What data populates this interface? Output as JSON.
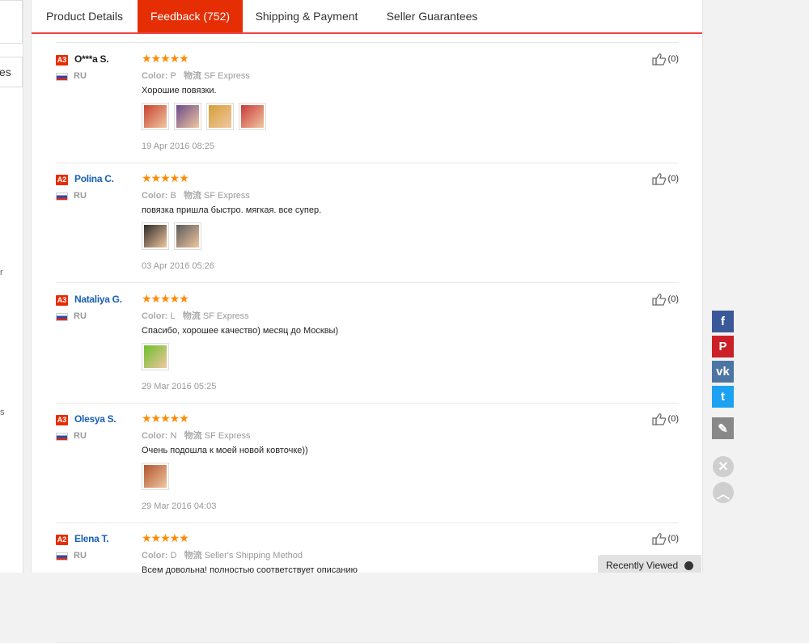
{
  "tabs": [
    {
      "label": "Product Details"
    },
    {
      "label": "Feedback (752)"
    },
    {
      "label": "Shipping & Payment"
    },
    {
      "label": "Seller Guarantees"
    }
  ],
  "left_fragments": {
    "es": "es",
    "r": "r",
    "s": "s"
  },
  "colors": {
    "accent": "#e62e04",
    "star": "#ff8a00",
    "link": "#1a5fb4"
  },
  "reviews": [
    {
      "badge": "A3",
      "name": "O***a S.",
      "country": "RU",
      "stars": "★★★★★",
      "color_key": "Color:",
      "color_val": "P",
      "ship_key": "物流",
      "ship_val": "SF Express",
      "text": "Хорошие повязки.",
      "date": "19 Apr 2016 08:25",
      "likes": "(0)",
      "thumb_colors": [
        "#c6422f",
        "#6b4a8a",
        "#d6a03a",
        "#c83a3a"
      ]
    },
    {
      "badge": "A2",
      "name": "Polina C.",
      "country": "RU",
      "stars": "★★★★★",
      "color_key": "Color:",
      "color_val": "B",
      "ship_key": "物流",
      "ship_val": "SF Express",
      "text": "повязка пришла быстро. мягкая. все супер.",
      "date": "03 Apr 2016 05:26",
      "likes": "(0)",
      "thumb_colors": [
        "#2e2a28",
        "#5a5a5a"
      ]
    },
    {
      "badge": "A3",
      "name": "Nataliya G.",
      "country": "RU",
      "stars": "★★★★★",
      "color_key": "Color:",
      "color_val": "L",
      "ship_key": "物流",
      "ship_val": "SF Express",
      "text": "Спасибо, хорошее качество) месяц до Москвы)",
      "date": "29 Mar 2016 05:25",
      "likes": "(0)",
      "thumb_colors": [
        "#6bbf2a"
      ]
    },
    {
      "badge": "A3",
      "name": "Olesya S.",
      "country": "RU",
      "stars": "★★★★★",
      "color_key": "Color:",
      "color_val": "N",
      "ship_key": "物流",
      "ship_val": "SF Express",
      "text": "Очень подошла к моей новой ковточке))",
      "date": "29 Mar 2016 04:03",
      "likes": "(0)",
      "thumb_colors": [
        "#b0552e"
      ]
    },
    {
      "badge": "A2",
      "name": "Elena T.",
      "country": "RU",
      "stars": "★★★★★",
      "color_key": "Color:",
      "color_val": "D",
      "ship_key": "物流",
      "ship_val": "Seller's Shipping Method",
      "text": "Всем довольна! полностью соответствует описанию",
      "date": "",
      "likes": "(0)",
      "thumb_colors": []
    }
  ],
  "social": [
    {
      "icon": "facebook-icon",
      "glyph": "f",
      "color": "#3b5998"
    },
    {
      "icon": "pinterest-icon",
      "glyph": "P",
      "color": "#cb2027"
    },
    {
      "icon": "vk-icon",
      "glyph": "vk",
      "color": "#4c75a3"
    },
    {
      "icon": "twitter-icon",
      "glyph": "t",
      "color": "#1da1f2"
    },
    {
      "icon": "edit-icon",
      "glyph": "✎",
      "color": "#888888"
    }
  ],
  "recently_viewed": "Recently Viewed"
}
